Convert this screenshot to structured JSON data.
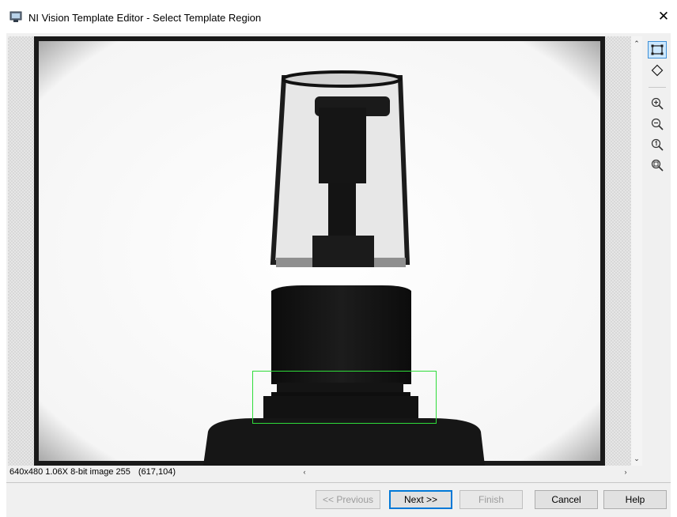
{
  "window": {
    "title": "NI Vision Template Editor - Select Template Region",
    "app_icon": "ni-vision-app-icon",
    "close_glyph": "✕"
  },
  "status": {
    "image_info": "640x480 1.06X 8-bit image 255",
    "cursor_coords": "(617,104)"
  },
  "scrollbars": {
    "up_arrow": "⌃",
    "down_arrow": "⌄",
    "left_arrow": "‹",
    "right_arrow": "›"
  },
  "tools": [
    {
      "name": "rectangle-roi-tool",
      "icon": "rectangle-icon",
      "active": true
    },
    {
      "name": "rotated-rectangle-roi-tool",
      "icon": "diamond-icon",
      "active": false
    },
    {
      "name": "zoom-in-tool",
      "icon": "zoom-in-icon",
      "active": false
    },
    {
      "name": "zoom-out-tool",
      "icon": "zoom-out-icon",
      "active": false
    },
    {
      "name": "zoom-1to1-tool",
      "icon": "zoom-actual-size-icon",
      "active": false
    },
    {
      "name": "zoom-fit-tool",
      "icon": "zoom-fit-icon",
      "active": false
    }
  ],
  "buttons": {
    "previous": "<< Previous",
    "next": "Next >>",
    "finish": "Finish",
    "cancel": "Cancel",
    "help": "Help"
  },
  "colors": {
    "roi_outline": "#2fdc3a",
    "accent": "#0078d7"
  }
}
